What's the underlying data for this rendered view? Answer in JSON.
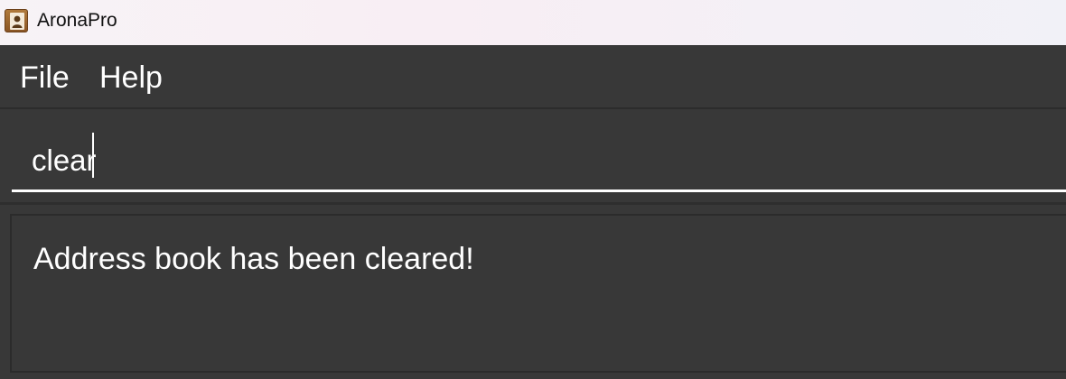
{
  "window": {
    "title": "AronaPro",
    "icon": "address-book-icon"
  },
  "menu": {
    "items": [
      {
        "label": "File"
      },
      {
        "label": "Help"
      }
    ]
  },
  "command": {
    "value": "clear",
    "placeholder": ""
  },
  "result": {
    "message": "Address book has been cleared!"
  },
  "colors": {
    "background": "#383838",
    "text": "#ffffff",
    "titlebar": "#f4f0f5",
    "input_underline": "#ffffff"
  }
}
